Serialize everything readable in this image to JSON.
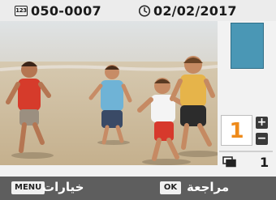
{
  "top": {
    "image_number_icon": "123",
    "image_number": "050-0007",
    "date": "02/02/2017"
  },
  "print": {
    "copies": "1",
    "plus": "+",
    "minus": "−",
    "sheets": "1"
  },
  "bottom": {
    "menu_key": "MENU",
    "menu_label": "خيارات",
    "ok_key": "OK",
    "ok_label": "مراجعة"
  },
  "colors": {
    "accent": "#ee8a1a",
    "thumbnail": "#4a97b5",
    "bottom_bar": "#5e5e5e"
  },
  "icons": [
    "image-number-icon",
    "clock-icon",
    "plus-icon",
    "minus-icon",
    "paper-sheets-icon"
  ]
}
